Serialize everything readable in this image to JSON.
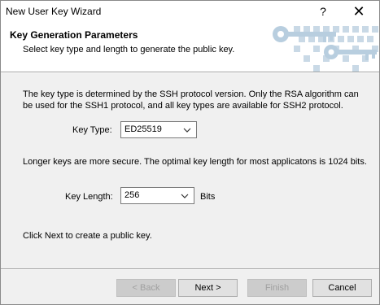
{
  "window": {
    "title": "New User Key Wizard",
    "help_glyph": "?",
    "close_glyph": "✕"
  },
  "header": {
    "title": "Key Generation Parameters",
    "subtitle": "Select key type and length to generate the public key."
  },
  "body": {
    "description": "The key type is determined by the SSH protocol version. Only the RSA algorithm can be used for the SSH1 protocol, and all key types are available for SSH2 protocol.",
    "key_type_label": "Key Type:",
    "key_type_value": "ED25519",
    "longer_note": "Longer keys are more secure. The optimal key length for most applicatons is 1024 bits.",
    "key_length_label": "Key Length:",
    "key_length_value": "256",
    "bits_label": "Bits",
    "click_next": "Click Next to create a public key."
  },
  "buttons": {
    "back": "< Back",
    "next": "Next >",
    "finish": "Finish",
    "cancel": "Cancel"
  }
}
